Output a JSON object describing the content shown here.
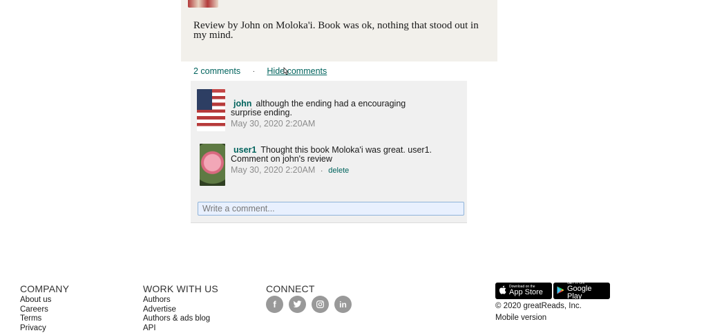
{
  "review": {
    "text": "Review by John on Moloka'i. Book was ok, nothing that stood out in my mind."
  },
  "comments_bar": {
    "count_label": "2 comments",
    "separator": "·",
    "hide_label": "Hide comments"
  },
  "comments": [
    {
      "user": "john",
      "text": "although the ending had a encouraging surprise ending.",
      "timestamp": "May 30, 2020 2:20AM",
      "avatar_icon": "american-flag-avatar"
    },
    {
      "user": "user1",
      "text": "Thought this book Moloka'i was great. user1. Comment on john's review",
      "timestamp": "May 30, 2020 2:20AM",
      "separator": "·",
      "delete_label": "delete",
      "avatar_icon": "pink-rose-avatar"
    }
  ],
  "comment_input": {
    "placeholder": "Write a comment..."
  },
  "footer": {
    "company": {
      "heading": "COMPANY",
      "links": [
        "About us",
        "Careers",
        "Terms",
        "Privacy"
      ]
    },
    "work_with_us": {
      "heading": "WORK WITH US",
      "links": [
        "Authors",
        "Advertise",
        "Authors & ads blog",
        "API"
      ]
    },
    "connect": {
      "heading": "CONNECT",
      "icons": [
        "facebook-icon",
        "twitter-icon",
        "instagram-icon",
        "linkedin-icon"
      ]
    },
    "apps": {
      "app_store_small": "Download on the",
      "app_store_big": "App Store",
      "google_play_small": "GET IT ON",
      "google_play_big": "Google Play"
    },
    "copyright": "© 2020 greatReads, Inc.",
    "mobile_version": "Mobile version"
  },
  "colors": {
    "link": "#00635d",
    "review_bg": "#f2f0eb",
    "comments_bg": "#f0f0f0",
    "social_icon_bg": "#999999"
  }
}
